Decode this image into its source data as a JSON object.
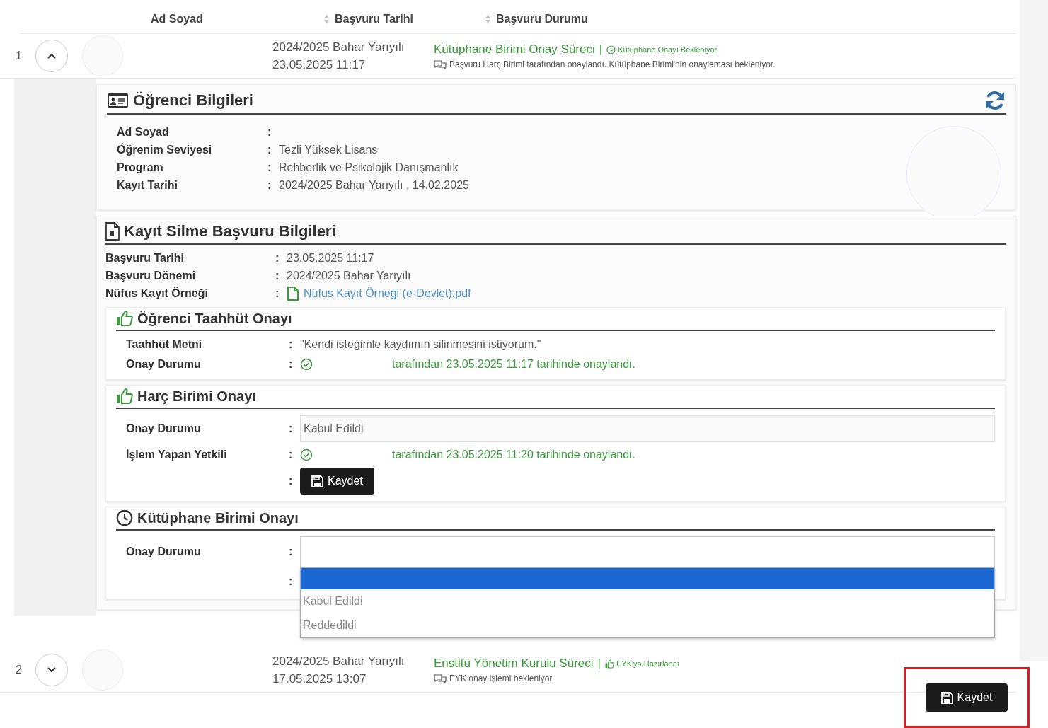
{
  "table": {
    "columns": [
      {
        "label": "Ad Soyad",
        "sortable": false
      },
      {
        "label": "Başvuru Tarihi",
        "sortable": true
      },
      {
        "label": "Başvuru Durumu",
        "sortable": true
      }
    ],
    "rows": [
      {
        "index": "1",
        "expanded": true,
        "term": "2024/2025 Bahar Yarıyılı",
        "date": "23.05.2025 11:17",
        "status": "Kütüphane Birimi Onay Süreci",
        "separator": "|",
        "badge": {
          "kind": "clock",
          "label": "Kütüphane Onayı Bekleniyor"
        },
        "note": "Başvuru Harç Birimi tarafından onaylandı. Kütüphane Birimi'nin onaylaması bekleniyor."
      },
      {
        "index": "2",
        "expanded": false,
        "term": "2024/2025 Bahar Yarıyılı",
        "date": "17.05.2025 13:07",
        "status": "Enstitü Yönetim Kurulu Süreci",
        "separator": "|",
        "badge": {
          "kind": "thumb",
          "label": "EYK'ya Hazırlandı"
        },
        "note": "EYK onay işlemi bekleniyor."
      }
    ]
  },
  "student_info": {
    "title": "Öğrenci Bilgileri",
    "fields": [
      {
        "label": "Ad Soyad",
        "sep": ":",
        "kind": "text"
      },
      {
        "label": "Öğrenim Seviyesi",
        "sep": ":",
        "kind": "text",
        "value": "Tezli Yüksek Lisans"
      },
      {
        "label": "Program",
        "sep": ":",
        "kind": "text",
        "value": "Rehberlik ve Psikolojik Danışmanlık"
      },
      {
        "label": "Kayıt Tarihi",
        "sep": ":",
        "kind": "text",
        "value": "2024/2025 Bahar Yarıyılı , 14.02.2025"
      }
    ]
  },
  "application": {
    "title": "Kayıt Silme Başvuru Bilgileri",
    "fields": [
      {
        "label": "Başvuru Tarihi",
        "sep": ":",
        "kind": "text",
        "value": "23.05.2025 11:17"
      },
      {
        "label": "Başvuru Dönemi",
        "sep": ":",
        "kind": "text",
        "value": "2024/2025 Bahar Yarıyılı"
      },
      {
        "label": "Nüfus Kayıt Örneği",
        "sep": ":",
        "kind": "file",
        "value": "Nüfus Kayıt Örneği (e-Devlet).pdf"
      }
    ],
    "sections": [
      {
        "title": "Öğrenci Taahhüt Onayı",
        "kind": "thumb",
        "fields": [
          {
            "label": "Taahhüt Metni",
            "sep": ":",
            "kind": "text",
            "value": "\"Kendi isteğimle kaydımın silinmesini istiyorum.\""
          },
          {
            "label": "Onay Durumu",
            "sep": ":",
            "kind": "approval",
            "value": "tarafından 23.05.2025 11:17 tarihinde onaylandı."
          }
        ]
      },
      {
        "title": "Harç Birimi Onayı",
        "kind": "thumb",
        "fields": [
          {
            "label": "Onay Durumu",
            "sep": ":",
            "kind": "input",
            "value": "Kabul Edildi"
          },
          {
            "label": "İşlem Yapan Yetkili",
            "sep": ":",
            "kind": "approval",
            "value": "tarafından 23.05.2025 11:20 tarihinde onaylandı."
          },
          {
            "sep": ":",
            "kind": "button",
            "value": "Kaydet"
          }
        ]
      },
      {
        "title": "Kütüphane Birimi Onayı",
        "kind": "clock",
        "fields": [
          {
            "label": "Onay Durumu",
            "sep": ":",
            "kind": "select",
            "open": true,
            "options": [
              {
                "label": "Kabul Edildi",
                "selected": false
              },
              {
                "label": "Reddedildi",
                "selected": false
              }
            ]
          },
          {
            "sep": ":",
            "kind": "blank"
          }
        ]
      }
    ]
  },
  "footer": {
    "button": "Kaydet",
    "highlighted": true
  }
}
